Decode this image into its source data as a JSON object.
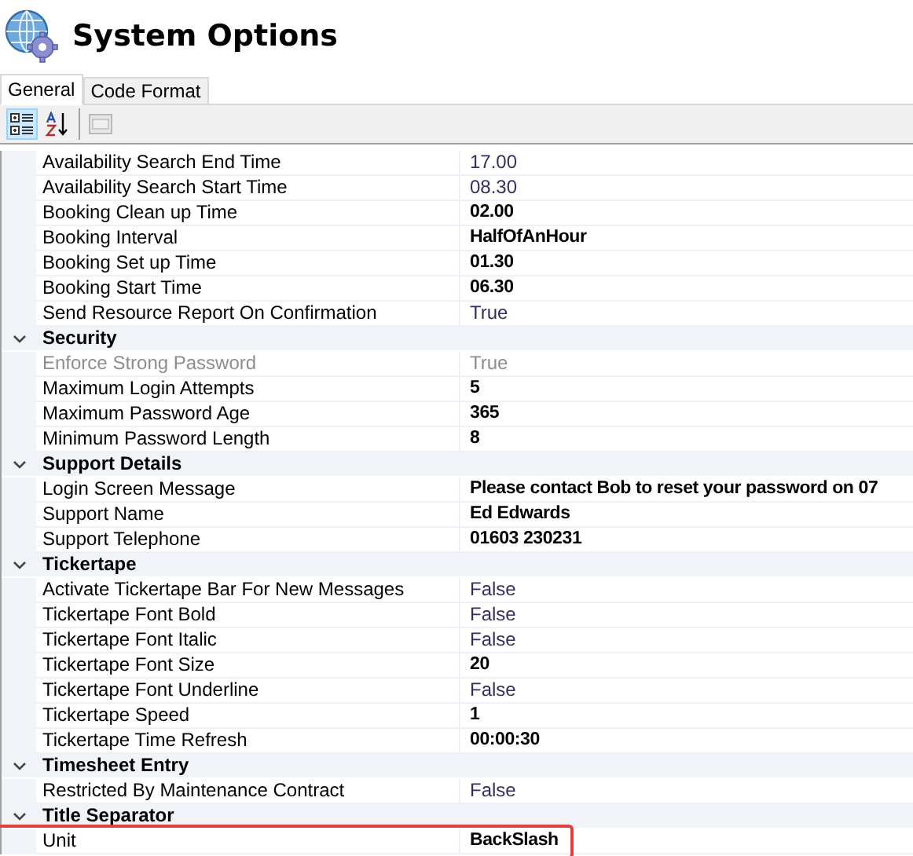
{
  "window": {
    "title": "System Options"
  },
  "tabs": [
    {
      "label": "General",
      "selected": true
    },
    {
      "label": "Code Format",
      "selected": false
    }
  ],
  "toolbar": [
    {
      "kind": "categorized",
      "selected": true,
      "disabled": false
    },
    {
      "kind": "alphabetical",
      "selected": false,
      "disabled": false
    },
    {
      "kind": "property-pages",
      "selected": false,
      "disabled": true
    }
  ],
  "sections": [
    {
      "rows": [
        {
          "name": "Availability Search End Time",
          "value": "17.00",
          "modified": false,
          "disabled": false,
          "highlighted": false
        },
        {
          "name": "Availability Search Start Time",
          "value": "08.30",
          "modified": false,
          "disabled": false,
          "highlighted": false
        },
        {
          "name": "Booking Clean up Time",
          "value": "02.00",
          "modified": true,
          "disabled": false,
          "highlighted": false
        },
        {
          "name": "Booking Interval",
          "value": "HalfOfAnHour",
          "modified": true,
          "disabled": false,
          "highlighted": false
        },
        {
          "name": "Booking Set up Time",
          "value": "01.30",
          "modified": true,
          "disabled": false,
          "highlighted": false
        },
        {
          "name": "Booking Start Time",
          "value": "06.30",
          "modified": true,
          "disabled": false,
          "highlighted": false
        },
        {
          "name": "Send Resource Report On Confirmation",
          "value": "True",
          "modified": false,
          "disabled": false,
          "highlighted": false
        }
      ]
    },
    {
      "title": "Security",
      "expanded": true,
      "rows": [
        {
          "name": "Enforce Strong Password",
          "value": "True",
          "modified": false,
          "disabled": true,
          "highlighted": false
        },
        {
          "name": "Maximum Login Attempts",
          "value": "5",
          "modified": true,
          "disabled": false,
          "highlighted": false
        },
        {
          "name": "Maximum Password Age",
          "value": "365",
          "modified": true,
          "disabled": false,
          "highlighted": false
        },
        {
          "name": "Minimum Password Length",
          "value": "8",
          "modified": true,
          "disabled": false,
          "highlighted": false
        }
      ]
    },
    {
      "title": "Support Details",
      "expanded": true,
      "rows": [
        {
          "name": "Login Screen Message",
          "value": "Please contact Bob to reset your password on 07",
          "modified": true,
          "disabled": false,
          "highlighted": false
        },
        {
          "name": "Support Name",
          "value": "Ed Edwards",
          "modified": true,
          "disabled": false,
          "highlighted": false
        },
        {
          "name": "Support Telephone",
          "value": "01603 230231",
          "modified": true,
          "disabled": false,
          "highlighted": false
        }
      ]
    },
    {
      "title": "Tickertape",
      "expanded": true,
      "rows": [
        {
          "name": "Activate Tickertape Bar For New Messages",
          "value": "False",
          "modified": false,
          "disabled": false,
          "highlighted": false
        },
        {
          "name": "Tickertape Font Bold",
          "value": "False",
          "modified": false,
          "disabled": false,
          "highlighted": false
        },
        {
          "name": "Tickertape Font Italic",
          "value": "False",
          "modified": false,
          "disabled": false,
          "highlighted": false
        },
        {
          "name": "Tickertape Font Size",
          "value": "20",
          "modified": true,
          "disabled": false,
          "highlighted": false
        },
        {
          "name": "Tickertape Font Underline",
          "value": "False",
          "modified": false,
          "disabled": false,
          "highlighted": false
        },
        {
          "name": "Tickertape Speed",
          "value": "1",
          "modified": true,
          "disabled": false,
          "highlighted": false
        },
        {
          "name": "Tickertape Time Refresh",
          "value": "00:00:30",
          "modified": true,
          "disabled": false,
          "highlighted": false
        }
      ]
    },
    {
      "title": "Timesheet Entry",
      "expanded": true,
      "rows": [
        {
          "name": "Restricted By Maintenance Contract",
          "value": "False",
          "modified": false,
          "disabled": false,
          "highlighted": false
        }
      ]
    },
    {
      "title": "Title Separator",
      "expanded": true,
      "rows": [
        {
          "name": "Unit",
          "value": "BackSlash",
          "modified": true,
          "disabled": false,
          "highlighted": true
        }
      ]
    }
  ]
}
